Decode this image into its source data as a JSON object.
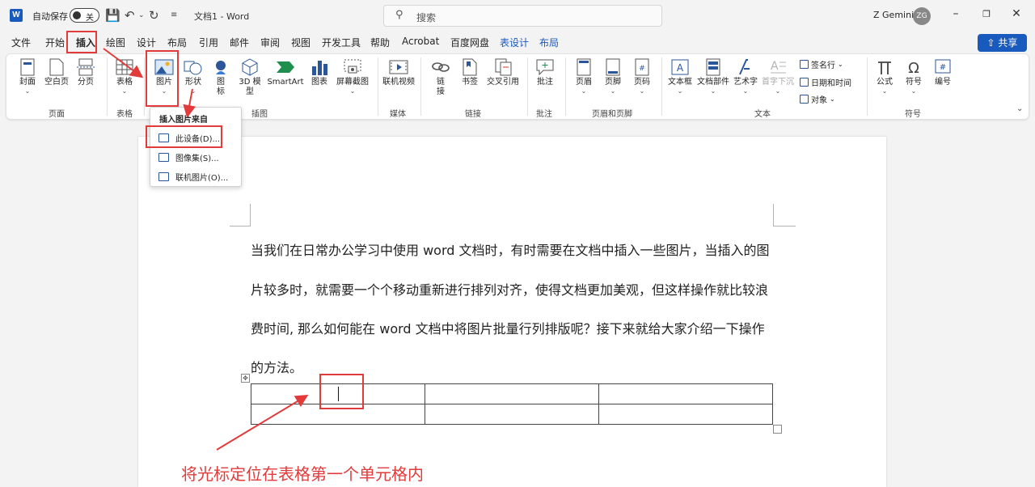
{
  "titlebar": {
    "app_logo": "W",
    "autosave_label": "自动保存",
    "autosave_state": "关",
    "doc_title": "文档1 - Word",
    "search_placeholder": "搜索",
    "user_name": "Z Gemini",
    "user_initials": "ZG"
  },
  "menu": {
    "items": [
      "文件",
      "开始",
      "插入",
      "绘图",
      "设计",
      "布局",
      "引用",
      "邮件",
      "审阅",
      "视图",
      "开发工具",
      "帮助",
      "Acrobat",
      "百度网盘",
      "表设计",
      "布局"
    ],
    "active": "插入",
    "share_label": "共享"
  },
  "ribbon": {
    "pages": {
      "cover": "封面",
      "blank": "空白页",
      "break": "分页",
      "group": "页面"
    },
    "tables": {
      "table": "表格",
      "group": "表格"
    },
    "illustrations": {
      "picture": "图片",
      "shapes": "形状",
      "icons_line1": "图",
      "icons_line2": "标",
      "model3d_line1": "3D 模",
      "model3d_line2": "型",
      "smartart": "SmartArt",
      "chart": "图表",
      "screenshot": "屏幕截图",
      "group": "插图"
    },
    "media": {
      "online_video": "联机视频",
      "group": "媒体"
    },
    "links": {
      "link_line1": "链",
      "link_line2": "接",
      "bookmark": "书签",
      "crossref": "交叉引用",
      "group": "链接"
    },
    "comments": {
      "comment": "批注",
      "group": "批注"
    },
    "header_footer": {
      "header": "页眉",
      "footer": "页脚",
      "page_number": "页码",
      "group": "页眉和页脚"
    },
    "text": {
      "textbox": "文本框",
      "quickparts": "文档部件",
      "wordart": "艺术字",
      "dropcap": "首字下沉",
      "signature": "签名行",
      "datetime": "日期和时间",
      "object": "对象",
      "group": "文本"
    },
    "symbols": {
      "equation": "公式",
      "symbol": "符号",
      "number": "编号",
      "group": "符号"
    }
  },
  "dropdown": {
    "header": "插入图片来自",
    "items": [
      "此设备(D)...",
      "图像集(S)...",
      "联机图片(O)..."
    ]
  },
  "document": {
    "lines": [
      "当我们在日常办公学习中使用 word 文档时，有时需要在文档中插入一些图片，当插入的图",
      "片较多时，就需要一个个移动重新进行排列对齐，使得文档更加美观，但这样操作就比较浪",
      "费时间, 那么如何能在 word 文档中将图片批量行列排版呢？接下来就给大家介绍一下操作",
      "的方法。"
    ]
  },
  "annotation": {
    "caption": "将光标定位在表格第一个单元格内",
    "color": "#e23b3b"
  },
  "colors": {
    "accent": "#185abd",
    "annotation": "#e23b3b"
  }
}
